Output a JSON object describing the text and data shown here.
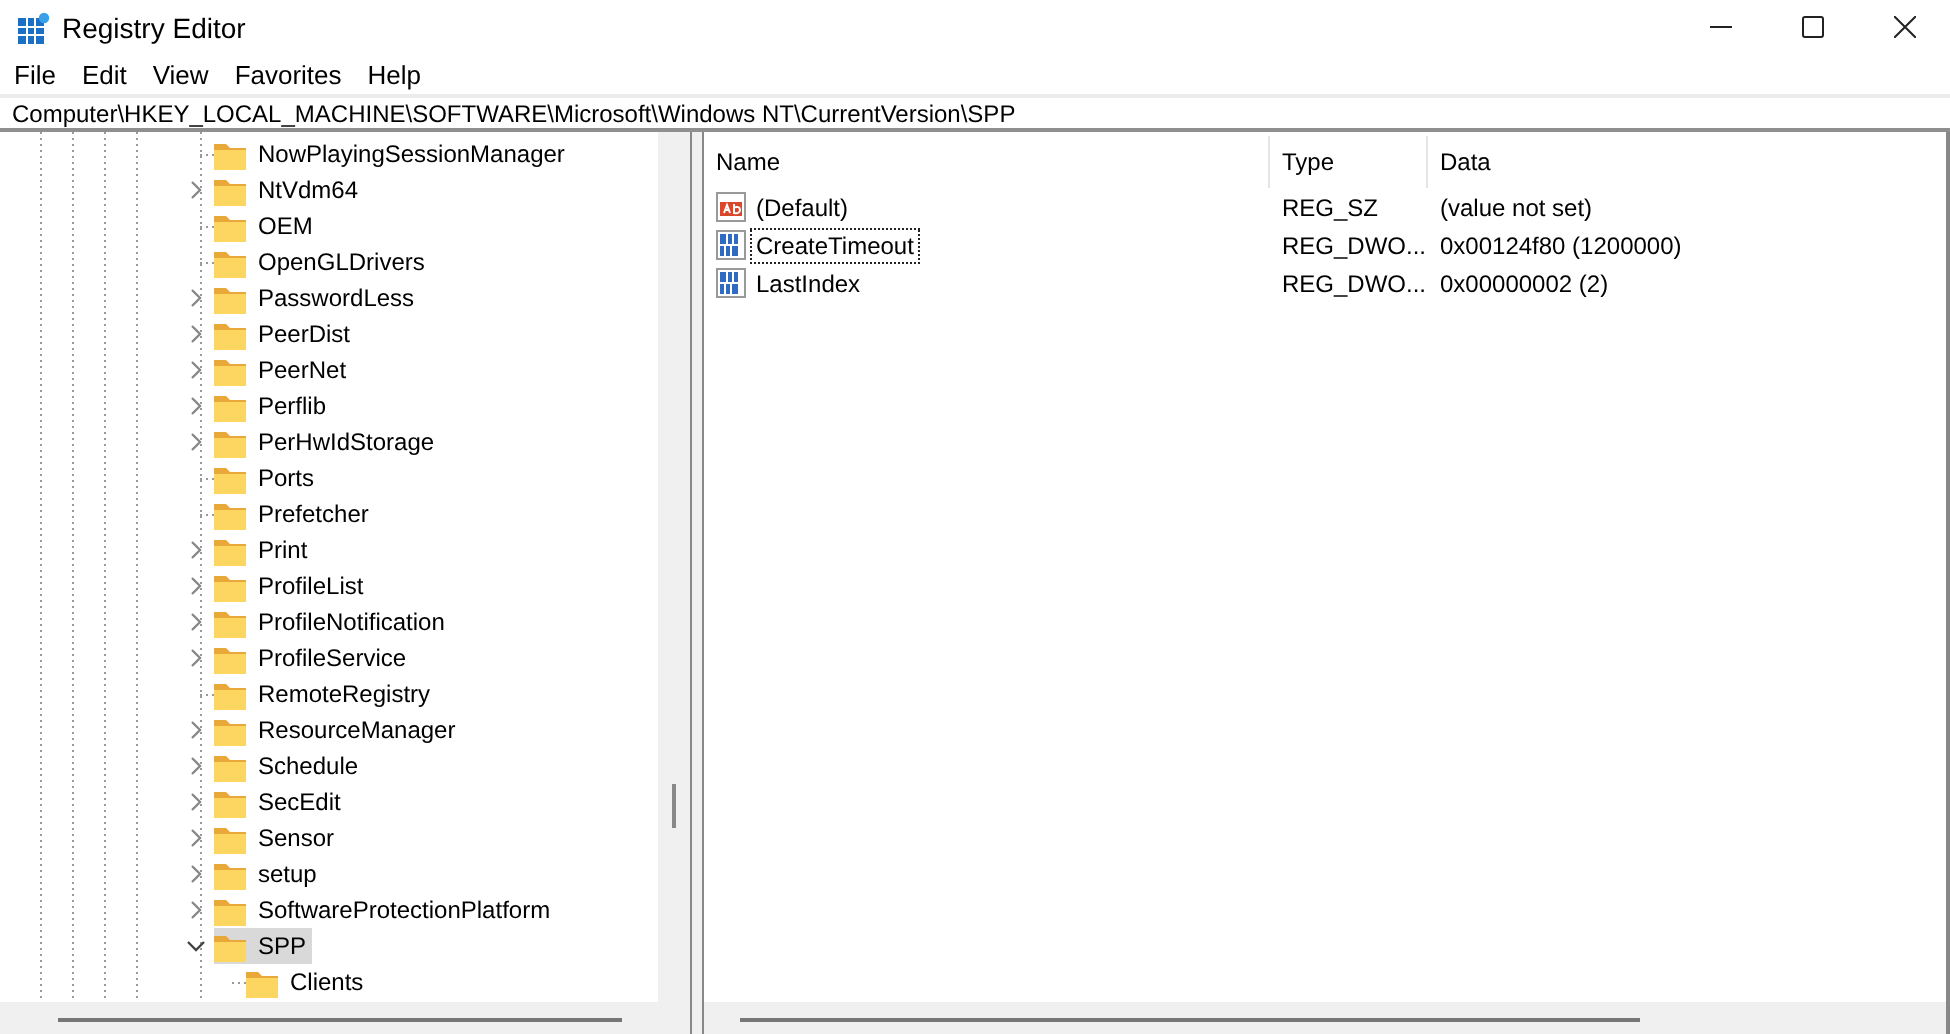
{
  "window": {
    "title": "Registry Editor"
  },
  "menu": [
    "File",
    "Edit",
    "View",
    "Favorites",
    "Help"
  ],
  "address": {
    "value": "Computer\\HKEY_LOCAL_MACHINE\\SOFTWARE\\Microsoft\\Windows NT\\CurrentVersion\\SPP"
  },
  "tree": {
    "items": [
      {
        "name": "NowPlayingSessionManager",
        "expandable": false,
        "selected": false
      },
      {
        "name": "NtVdm64",
        "expandable": true,
        "expanded": false,
        "selected": false
      },
      {
        "name": "OEM",
        "expandable": false,
        "selected": false
      },
      {
        "name": "OpenGLDrivers",
        "expandable": false,
        "selected": false
      },
      {
        "name": "PasswordLess",
        "expandable": true,
        "expanded": false,
        "selected": false
      },
      {
        "name": "PeerDist",
        "expandable": true,
        "expanded": false,
        "selected": false
      },
      {
        "name": "PeerNet",
        "expandable": true,
        "expanded": false,
        "selected": false
      },
      {
        "name": "Perflib",
        "expandable": true,
        "expanded": false,
        "selected": false
      },
      {
        "name": "PerHwIdStorage",
        "expandable": true,
        "expanded": false,
        "selected": false
      },
      {
        "name": "Ports",
        "expandable": false,
        "selected": false
      },
      {
        "name": "Prefetcher",
        "expandable": false,
        "selected": false
      },
      {
        "name": "Print",
        "expandable": true,
        "expanded": false,
        "selected": false
      },
      {
        "name": "ProfileList",
        "expandable": true,
        "expanded": false,
        "selected": false
      },
      {
        "name": "ProfileNotification",
        "expandable": true,
        "expanded": false,
        "selected": false
      },
      {
        "name": "ProfileService",
        "expandable": true,
        "expanded": false,
        "selected": false
      },
      {
        "name": "RemoteRegistry",
        "expandable": false,
        "selected": false
      },
      {
        "name": "ResourceManager",
        "expandable": true,
        "expanded": false,
        "selected": false
      },
      {
        "name": "Schedule",
        "expandable": true,
        "expanded": false,
        "selected": false
      },
      {
        "name": "SecEdit",
        "expandable": true,
        "expanded": false,
        "selected": false
      },
      {
        "name": "Sensor",
        "expandable": true,
        "expanded": false,
        "selected": false
      },
      {
        "name": "setup",
        "expandable": true,
        "expanded": false,
        "selected": false
      },
      {
        "name": "SoftwareProtectionPlatform",
        "expandable": true,
        "expanded": false,
        "selected": false
      },
      {
        "name": "SPP",
        "expandable": true,
        "expanded": true,
        "selected": true,
        "children": [
          {
            "name": "Clients",
            "expandable": false,
            "selected": false
          }
        ]
      }
    ]
  },
  "values": {
    "columns": [
      "Name",
      "Type",
      "Data"
    ],
    "rows": [
      {
        "kind": "string",
        "name": "(Default)",
        "type": "REG_SZ",
        "data": "(value not set)",
        "focused": false
      },
      {
        "kind": "binary",
        "name": "CreateTimeout",
        "type": "REG_DWO...",
        "data": "0x00124f80 (1200000)",
        "focused": true
      },
      {
        "kind": "binary",
        "name": "LastIndex",
        "type": "REG_DWO...",
        "data": "0x00000002 (2)",
        "focused": false
      }
    ]
  }
}
